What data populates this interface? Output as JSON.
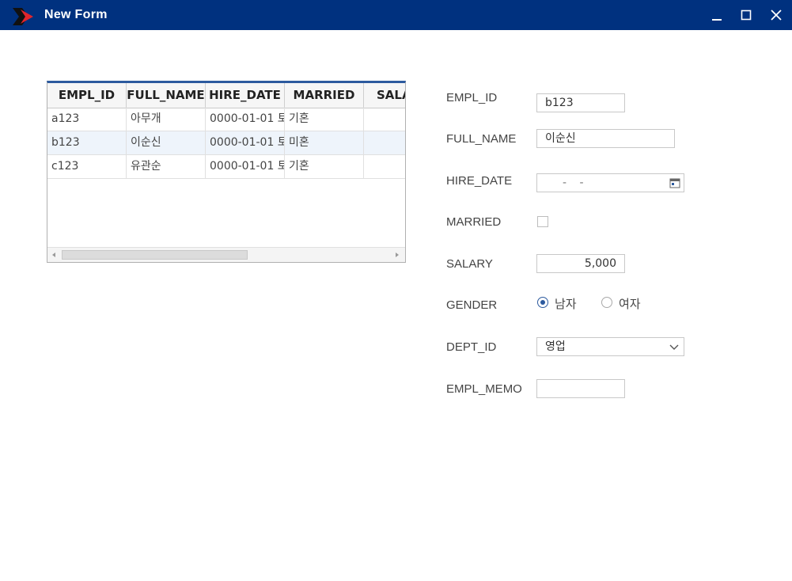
{
  "window": {
    "title": "New Form",
    "accent_color": "#00317f",
    "icons": [
      "app-logo-icon",
      "minimize-icon",
      "maximize-icon",
      "close-icon"
    ]
  },
  "grid": {
    "columns": [
      "EMPL_ID",
      "FULL_NAME",
      "HIRE_DATE",
      "MARRIED",
      "SALARY"
    ],
    "rows": [
      {
        "empl_id": "a123",
        "full_name": "아무개",
        "hire_date": "0000-01-01 토",
        "married": "기혼",
        "salary": ""
      },
      {
        "empl_id": "b123",
        "full_name": "이순신",
        "hire_date": "0000-01-01 토",
        "married": "미혼",
        "salary": ""
      },
      {
        "empl_id": "c123",
        "full_name": "유관순",
        "hire_date": "0000-01-01 토",
        "married": "기혼",
        "salary": ""
      }
    ],
    "selected_row": 1
  },
  "form": {
    "empl_id": {
      "label": "EMPL_ID",
      "value": "b123"
    },
    "full_name": {
      "label": "FULL_NAME",
      "value": "이순신"
    },
    "hire_date": {
      "label": "HIRE_DATE",
      "value": "- -"
    },
    "married": {
      "label": "MARRIED",
      "checked": false
    },
    "salary": {
      "label": "SALARY",
      "value": "5,000"
    },
    "gender": {
      "label": "GENDER",
      "options": [
        "남자",
        "여자"
      ],
      "selected": "남자"
    },
    "dept_id": {
      "label": "DEPT_ID",
      "value": "영업"
    },
    "empl_memo": {
      "label": "EMPL_MEMO",
      "value": ""
    }
  }
}
